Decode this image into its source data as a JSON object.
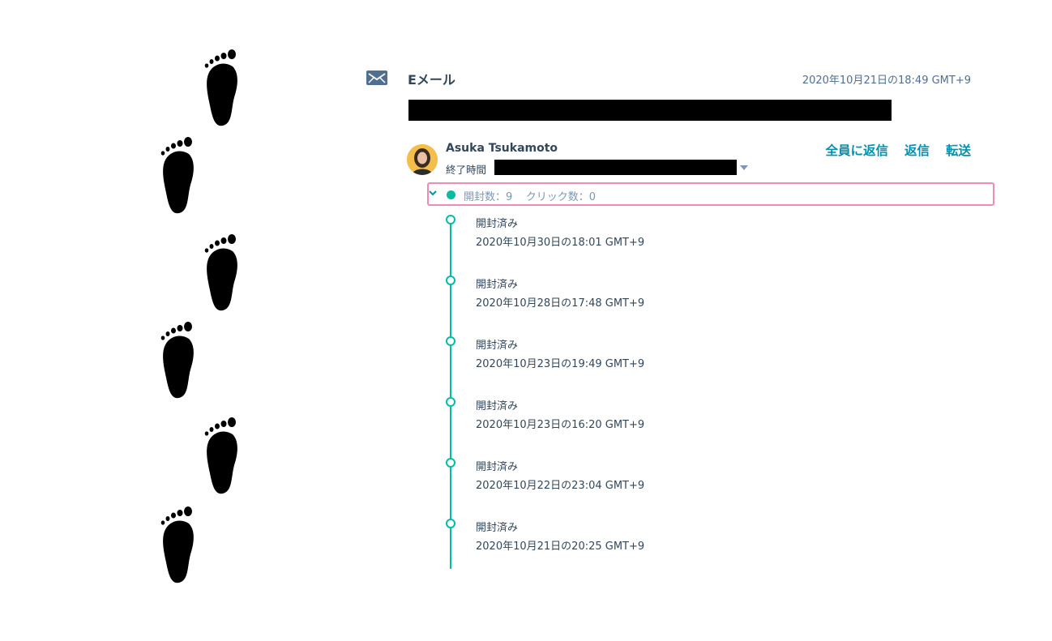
{
  "email": {
    "type_label": "Eメール",
    "timestamp": "2020年10月21日の18:49 GMT+9",
    "sender_name": "Asuka Tsukamoto",
    "end_time_label": "終了時間",
    "actions": {
      "reply_all": "全員に返信",
      "reply": "返信",
      "forward": "転送"
    },
    "stats": "開封数：9    クリック数：0"
  },
  "timeline": [
    {
      "label": "開封済み",
      "date": "2020年10月30日の18:01 GMT+9"
    },
    {
      "label": "開封済み",
      "date": "2020年10月28日の17:48 GMT+9"
    },
    {
      "label": "開封済み",
      "date": "2020年10月23日の19:49 GMT+9"
    },
    {
      "label": "開封済み",
      "date": "2020年10月23日の16:20 GMT+9"
    },
    {
      "label": "開封済み",
      "date": "2020年10月22日の23:04 GMT+9"
    },
    {
      "label": "開封済み",
      "date": "2020年10月21日の20:25 GMT+9"
    }
  ],
  "colors": {
    "accent": "#00bda5",
    "link": "#0091ae",
    "highlight_border": "#ee8bb6",
    "text": "#33475b"
  },
  "icons": [
    "footprint-icon",
    "mail-icon",
    "chevron-down-icon",
    "caret-down-icon"
  ]
}
